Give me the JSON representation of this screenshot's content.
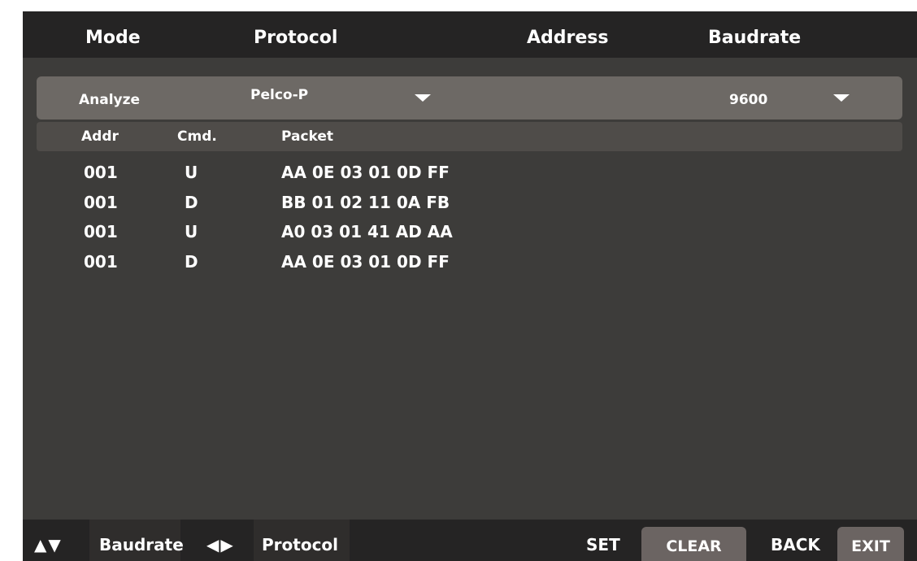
{
  "header": {
    "mode": "Mode",
    "protocol": "Protocol",
    "address": "Address",
    "baudrate": "Baudrate"
  },
  "settings": {
    "mode_value": "Analyze",
    "protocol_value": "Pelco-P",
    "baudrate_value": "9600"
  },
  "columns": {
    "addr": "Addr",
    "cmd": "Cmd.",
    "packet": "Packet"
  },
  "rows": [
    {
      "addr": "001",
      "cmd": "U",
      "packet": "AA 0E 03 01 0D FF"
    },
    {
      "addr": "001",
      "cmd": "D",
      "packet": "BB 01 02 11 0A FB"
    },
    {
      "addr": "001",
      "cmd": "U",
      "packet": "A0 03 01 41 AD AA"
    },
    {
      "addr": "001",
      "cmd": "D",
      "packet": "AA 0E 03 01 0D FF"
    }
  ],
  "footer": {
    "updown_keys": "▲▼",
    "baudrate_hint": "Baudrate",
    "leftright_keys": "◀▶",
    "protocol_hint": "Protocol",
    "set": "SET",
    "clear": "CLEAR",
    "back": "BACK",
    "exit": "EXIT"
  },
  "colors": {
    "header_bg": "#252424",
    "body_bg": "#3d3c3a",
    "selected_row_bg": "#6d6965",
    "button_bg": "#6b6462",
    "text": "#ffffff"
  },
  "icons": {
    "protocol_dropdown": "triangle-down",
    "baudrate_dropdown": "triangle-down"
  }
}
